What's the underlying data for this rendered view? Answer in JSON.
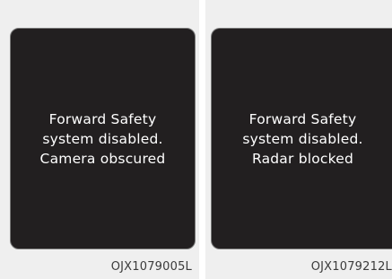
{
  "panels": [
    {
      "message_lines": [
        "Forward Safety",
        "system disabled.",
        "Camera obscured"
      ],
      "code": "OJX1079005L"
    },
    {
      "message_lines": [
        "Forward Safety",
        "system disabled.",
        "Radar blocked"
      ],
      "code": "OJX1079212L"
    }
  ],
  "colors": {
    "screen_background": "#221f20",
    "screen_text": "#ffffff",
    "panel_background": "#efefef"
  }
}
